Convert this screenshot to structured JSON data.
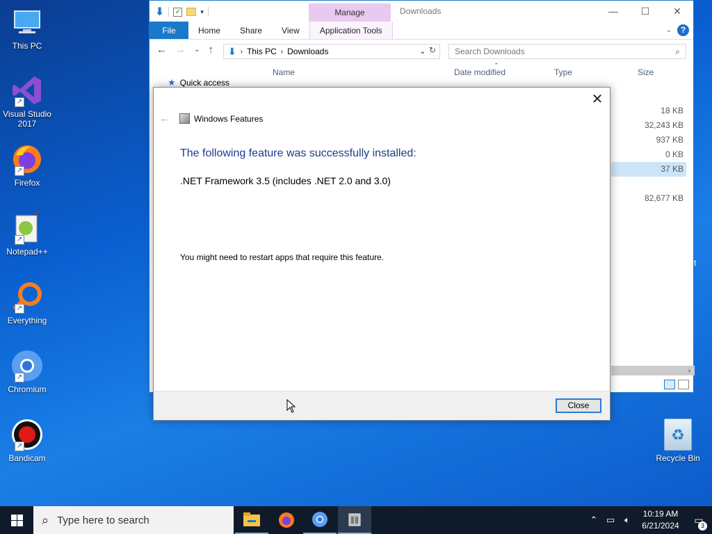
{
  "desktop": {
    "icons": [
      {
        "label": "This PC",
        "icon": "monitor-icon"
      },
      {
        "label": "Visual Studio 2017",
        "icon": "visual-studio-icon"
      },
      {
        "label": "Firefox",
        "icon": "firefox-icon"
      },
      {
        "label": "Notepad++",
        "icon": "notepadpp-icon"
      },
      {
        "label": "Everything",
        "icon": "search-magnifier-icon"
      },
      {
        "label": "Chromium",
        "icon": "chromium-icon"
      },
      {
        "label": "Bandicam",
        "icon": "record-icon"
      }
    ],
    "recycle_bin": {
      "label": "Recycle Bin",
      "icon": "recycle-bin-icon"
    }
  },
  "explorer": {
    "title": "Downloads",
    "manage_tab": "Manage",
    "ribbon_tabs": {
      "file": "File",
      "home": "Home",
      "share": "Share",
      "view": "View",
      "app_tools": "Application Tools"
    },
    "breadcrumb": {
      "root": "This PC",
      "current": "Downloads"
    },
    "search_placeholder": "Search Downloads",
    "columns": {
      "name": "Name",
      "date_modified": "Date modified",
      "type": "Type",
      "size": "Size"
    },
    "quick_access": "Quick access",
    "sizes": [
      "18 KB",
      "32,243 KB",
      "937 KB",
      "0 KB",
      "37 KB",
      "",
      "82,677 KB"
    ],
    "accent_color": "#1979ca"
  },
  "dialog": {
    "title": "Windows Features",
    "heading": "The following feature was successfully installed:",
    "feature": ".NET Framework 3.5 (includes .NET 2.0 and 3.0)",
    "note": "You might need to restart apps that require this feature.",
    "close_button": "Close",
    "heading_color": "#1c3a8c"
  },
  "taskbar": {
    "search_placeholder": "Type here to search",
    "time": "10:19 AM",
    "date": "6/21/2024",
    "notification_count": "3",
    "apps": [
      "file-explorer-icon",
      "firefox-icon",
      "chromium-icon",
      "windows-features-icon"
    ]
  }
}
